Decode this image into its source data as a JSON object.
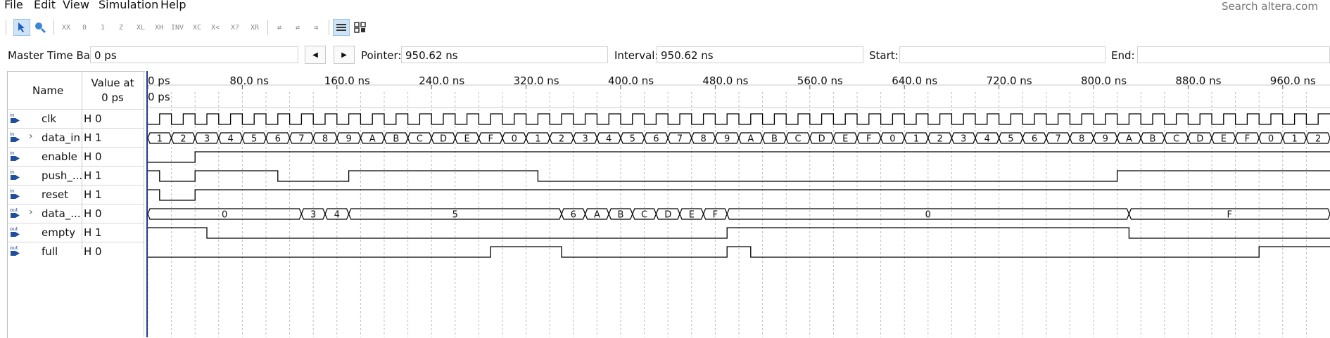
{
  "menubar": {
    "items": [
      "File",
      "Edit",
      "View",
      "Simulation",
      "Help"
    ],
    "search_placeholder": "Search altera.com"
  },
  "toolbar": {
    "icons": [
      "pointer-tool-icon",
      "zoom-tool-icon",
      "forcing-unknown-icon",
      "forcing-low-icon",
      "forcing-high-icon",
      "high-impedance-icon",
      "weak-low-icon",
      "weak-high-icon",
      "invert-icon",
      "count-value-icon",
      "clock-value-icon",
      "arbitrary-value-icon",
      "random-value-icon",
      "snap-to-grid-icon",
      "snap-transitions-icon",
      "group-icon",
      "grid-view-icon",
      "overwrite-clock-icon"
    ]
  },
  "timebar": {
    "master_label": "Master Time Bar:",
    "master_value": "0 ps",
    "prev_glyph": "◀",
    "next_glyph": "▶",
    "pointer_label": "Pointer:",
    "pointer_value": "950.62 ns",
    "interval_label": "Interval:",
    "interval_value": "950.62 ns",
    "start_label": "Start:",
    "start_value": "",
    "end_label": "End:",
    "end_value": ""
  },
  "columns": {
    "name_header": "Name",
    "value_header_line1": "Value at",
    "value_header_line2": "0 ps"
  },
  "time_axis": {
    "ticks": [
      "0 ps",
      "80.0 ns",
      "160.0 ns",
      "240.0 ns",
      "320.0 ns",
      "400.0 ns",
      "480.0 ns",
      "560.0 ns",
      "640.0 ns",
      "720.0 ns",
      "800.0 ns",
      "880.0 ns",
      "960.0 ns"
    ],
    "cursor_label": "0 ps"
  },
  "signals": [
    {
      "dir": "in",
      "name": "clk",
      "value": "H 0",
      "expandable": false
    },
    {
      "dir": "in",
      "name": "data_in",
      "value": "H 1",
      "expandable": true
    },
    {
      "dir": "in",
      "name": "enable",
      "value": "H 0",
      "expandable": false
    },
    {
      "dir": "in",
      "name": "push_...",
      "value": "H 1",
      "expandable": false
    },
    {
      "dir": "in",
      "name": "reset",
      "value": "H 1",
      "expandable": false
    },
    {
      "dir": "out",
      "name": "data_...",
      "value": "H 0",
      "expandable": true
    },
    {
      "dir": "out",
      "name": "empty",
      "value": "H 1",
      "expandable": false
    },
    {
      "dir": "out",
      "name": "full",
      "value": "H 0",
      "expandable": false
    }
  ],
  "waveforms": {
    "clk": {
      "kind": "clock",
      "period_ns": 20
    },
    "data_in": {
      "kind": "bus",
      "segments": [
        {
          "t0": 0,
          "t1": 20,
          "v": "1"
        },
        {
          "t0": 20,
          "t1": 40,
          "v": "2"
        },
        {
          "t0": 40,
          "t1": 60,
          "v": "3"
        },
        {
          "t0": 60,
          "t1": 80,
          "v": "4"
        },
        {
          "t0": 80,
          "t1": 100,
          "v": "5"
        },
        {
          "t0": 100,
          "t1": 120,
          "v": "6"
        },
        {
          "t0": 120,
          "t1": 140,
          "v": "7"
        },
        {
          "t0": 140,
          "t1": 160,
          "v": "8"
        },
        {
          "t0": 160,
          "t1": 180,
          "v": "9"
        },
        {
          "t0": 180,
          "t1": 200,
          "v": "A"
        },
        {
          "t0": 200,
          "t1": 220,
          "v": "B"
        },
        {
          "t0": 220,
          "t1": 240,
          "v": "C"
        },
        {
          "t0": 240,
          "t1": 260,
          "v": "D"
        },
        {
          "t0": 260,
          "t1": 280,
          "v": "E"
        },
        {
          "t0": 280,
          "t1": 300,
          "v": "F"
        },
        {
          "t0": 300,
          "t1": 320,
          "v": "0"
        },
        {
          "t0": 320,
          "t1": 340,
          "v": "1"
        },
        {
          "t0": 340,
          "t1": 360,
          "v": "2"
        },
        {
          "t0": 360,
          "t1": 380,
          "v": "3"
        },
        {
          "t0": 380,
          "t1": 400,
          "v": "4"
        },
        {
          "t0": 400,
          "t1": 420,
          "v": "5"
        },
        {
          "t0": 420,
          "t1": 440,
          "v": "6"
        },
        {
          "t0": 440,
          "t1": 460,
          "v": "7"
        },
        {
          "t0": 460,
          "t1": 480,
          "v": "8"
        },
        {
          "t0": 480,
          "t1": 500,
          "v": "9"
        },
        {
          "t0": 500,
          "t1": 520,
          "v": "A"
        },
        {
          "t0": 520,
          "t1": 540,
          "v": "B"
        },
        {
          "t0": 540,
          "t1": 560,
          "v": "C"
        },
        {
          "t0": 560,
          "t1": 580,
          "v": "D"
        },
        {
          "t0": 580,
          "t1": 600,
          "v": "E"
        },
        {
          "t0": 600,
          "t1": 620,
          "v": "F"
        },
        {
          "t0": 620,
          "t1": 640,
          "v": "0"
        },
        {
          "t0": 640,
          "t1": 660,
          "v": "1"
        },
        {
          "t0": 660,
          "t1": 680,
          "v": "2"
        },
        {
          "t0": 680,
          "t1": 700,
          "v": "3"
        },
        {
          "t0": 700,
          "t1": 720,
          "v": "4"
        },
        {
          "t0": 720,
          "t1": 740,
          "v": "5"
        },
        {
          "t0": 740,
          "t1": 760,
          "v": "6"
        },
        {
          "t0": 760,
          "t1": 780,
          "v": "7"
        },
        {
          "t0": 780,
          "t1": 800,
          "v": "8"
        },
        {
          "t0": 800,
          "t1": 820,
          "v": "9"
        },
        {
          "t0": 820,
          "t1": 840,
          "v": "A"
        },
        {
          "t0": 840,
          "t1": 860,
          "v": "B"
        },
        {
          "t0": 860,
          "t1": 880,
          "v": "C"
        },
        {
          "t0": 880,
          "t1": 900,
          "v": "D"
        },
        {
          "t0": 900,
          "t1": 920,
          "v": "E"
        },
        {
          "t0": 920,
          "t1": 940,
          "v": "F"
        },
        {
          "t0": 940,
          "t1": 960,
          "v": "0"
        },
        {
          "t0": 960,
          "t1": 980,
          "v": "1"
        },
        {
          "t0": 980,
          "t1": 1000,
          "v": "2"
        }
      ]
    },
    "enable": {
      "kind": "bit",
      "init": 0,
      "changes": [
        40
      ]
    },
    "push_": {
      "kind": "bit",
      "init": 1,
      "changes": [
        10,
        40,
        110,
        170,
        330,
        820
      ]
    },
    "reset": {
      "kind": "bit",
      "init": 1,
      "changes": [
        10,
        40
      ]
    },
    "data_out": {
      "kind": "bus",
      "segments": [
        {
          "t0": 0,
          "t1": 130,
          "v": "0"
        },
        {
          "t0": 130,
          "t1": 150,
          "v": "3"
        },
        {
          "t0": 150,
          "t1": 170,
          "v": "4"
        },
        {
          "t0": 170,
          "t1": 350,
          "v": "5"
        },
        {
          "t0": 350,
          "t1": 370,
          "v": "6"
        },
        {
          "t0": 370,
          "t1": 390,
          "v": "A"
        },
        {
          "t0": 390,
          "t1": 410,
          "v": "B"
        },
        {
          "t0": 410,
          "t1": 430,
          "v": "C"
        },
        {
          "t0": 430,
          "t1": 450,
          "v": "D"
        },
        {
          "t0": 450,
          "t1": 470,
          "v": "E"
        },
        {
          "t0": 470,
          "t1": 490,
          "v": "F"
        },
        {
          "t0": 490,
          "t1": 830,
          "v": "0"
        },
        {
          "t0": 830,
          "t1": 1000,
          "v": "F"
        }
      ]
    },
    "empty": {
      "kind": "bit",
      "init": 1,
      "changes": [
        50,
        490,
        830
      ]
    },
    "full": {
      "kind": "bit",
      "init": 0,
      "changes": [
        290,
        350,
        490,
        510,
        940
      ]
    }
  },
  "colors": {
    "wave": "#000000",
    "grid": "#bdbdbd",
    "cursor": "#1f3f8f",
    "in_icon": "#1f4f9a",
    "out_icon": "#1f4f9a",
    "active_tool": "#cfe3f7"
  }
}
